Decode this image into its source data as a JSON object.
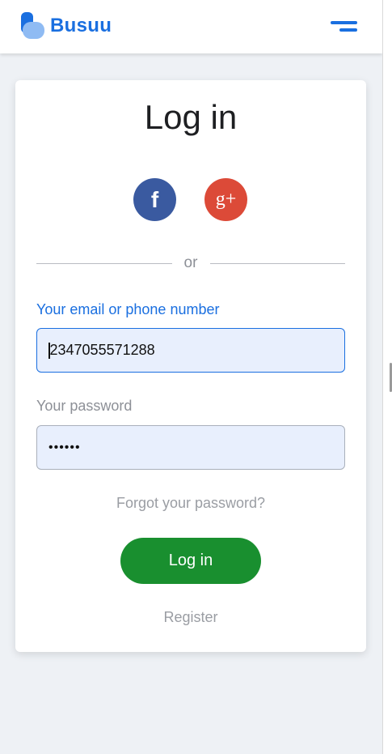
{
  "header": {
    "brand": "Busuu",
    "menu_icon": "hamburger-menu-icon"
  },
  "login": {
    "title": "Log in",
    "social": {
      "facebook_glyph": "f",
      "google_glyph": "g+",
      "facebook_icon": "facebook-icon",
      "google_icon": "google-plus-icon"
    },
    "divider_text": "or",
    "email_label": "Your email or phone number",
    "email_value": "2347055571288",
    "password_label": "Your password",
    "password_value": "••••••",
    "forgot_link": "Forgot your password?",
    "login_button": "Log in",
    "register_link": "Register"
  },
  "colors": {
    "brand_blue": "#1a6fe0",
    "login_green": "#198f2f",
    "facebook_blue": "#3a5aa0",
    "google_red": "#dc4a38",
    "input_bg": "#e8effd"
  }
}
